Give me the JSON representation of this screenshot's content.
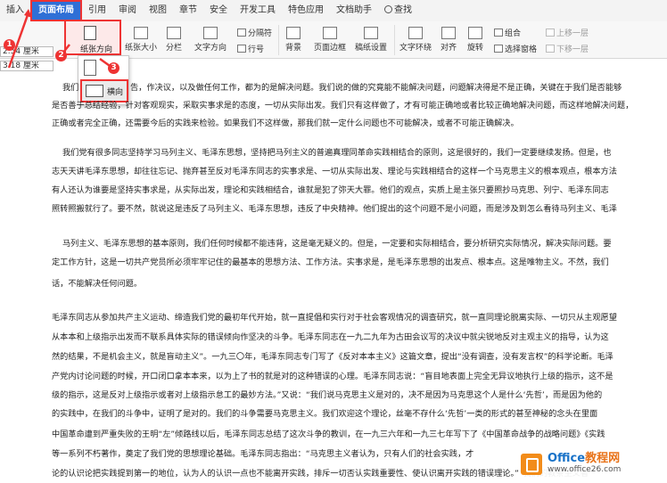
{
  "menubar": {
    "items": [
      "插入",
      "页面布局",
      "引用",
      "审阅",
      "视图",
      "章节",
      "安全",
      "开发工具",
      "特色应用",
      "文档助手"
    ],
    "search_label": "查找"
  },
  "ribbon": {
    "margin_top_value": "2.54 厘米",
    "margin_left_value": "3.18 厘米",
    "orientation_label": "纸张方向",
    "size_label": "纸张大小",
    "columns_label": "分栏",
    "text_direction_label": "文字方向",
    "page_break_label": "分隔符",
    "line_number_label": "行号",
    "background_label": "背景",
    "page_border_label": "页面边框",
    "draft_label": "稿纸设置",
    "text_wrap_label": "文字环绕",
    "align_label": "对齐",
    "rotate_label": "旋转",
    "group_label": "组合",
    "select_pane_label": "选择窗格",
    "bring_forward_label": "上移一层",
    "send_backward_label": "下移一层"
  },
  "orientation_menu": {
    "landscape_label": "横向"
  },
  "badges": [
    "1",
    "2",
    "3"
  ],
  "document": {
    "lines": [
      "我们",
      "告，作决议，以及做任何工作，都为的是解决问题。我们说的做的究竟能不能解决问题，问题解决得是不是正确，关键在于我们是否能够",
      "是否善于总结经验，针对客观现实，采取实事求是的态度，一切从实际出发。我们只有这样做了，才有可能正确地或者比较正确地解决问题，而这样地解决问题，",
      "正确或者完全正确，还需要今后的实践来检验。如果我们不这样做，那我们就一定什么问题也不可能解决，或者不可能正确解决。",
      "我们党有很多同志坚持学习马列主义、毛泽东思想，坚持把马列主义的普遍真理同革命实践相结合的原则，这是很好的，我们一定要继续发扬。但是，也",
      "志天天讲毛泽东思想，却往往忘记、抛弃甚至反对毛泽东同志的实事求是、一切从实际出发、理论与实践相结合的这样一个马克思主义的根本观点，根本方法",
      "有人还认为谁要是坚持实事求是，从实际出发，理论和实践相结合，谁就是犯了弥天大罪。他们的观点，实质上是主张只要照抄马克思、列宁、毛泽东同志",
      "照转照搬就行了。要不然，就说这是违反了马列主义、毛泽东思想，违反了中央精神。他们提出的这个问题不是小问题，而是涉及到怎么看待马列主义、毛泽",
      "马列主义、毛泽东思想的基本原则，我们任何时候都不能违背，这是毫无疑义的。但是，一定要和实际相结合，要分析研究实际情况，解决实际问题。要",
      "定工作方针，这是一切共产党员所必须牢牢记住的最基本的思想方法、工作方法。实事求是，是毛泽东思想的出发点、根本点。这是唯物主义。不然，我们",
      "话，不能解决任何问题。",
      "毛泽东同志从参加共产主义运动、缔造我们党的最初年代开始，就一直提倡和实行对于社会客观情况的调查研究，就一直同理论脱离实际、一切只从主观愿望",
      "从本本和上级指示出发而不联系具体实际的错误倾向作坚决的斗争。毛泽东同志在一九二九年为古田会议写的决议中就尖锐地反对主观主义的指导，认为这",
      "然的结果，不是机会主义，就是盲动主义”。一九三〇年，毛泽东同志专门写了《反对本本主义》这篇文章，提出“没有调查，没有发言权”的科学论断。毛泽",
      "产党内讨论问题的时候，开口闭口拿本本来，以为上了书的就是对的这种错误的心理。毛泽东同志说：“盲目地表面上完全无异议地执行上级的指示，这不是",
      "级的指示，这是反对上级指示或者对上级指示怠工的最妙方法。”又说：“我们说马克思主义是对的，决不是因为马克思这个人是什么‘先哲’，而是因为他的",
      "的实践中，在我们的斗争中，证明了是对的。我们的斗争需要马克思主义。我们欢迎这个理论，丝毫不存什么‘先哲’一类的形式的甚至神秘的念头在里面",
      "中国革命遭到严重失败的王明“左”倾路线以后，毛泽东同志总结了这次斗争的教训，在一九三六年和一九三七年写下了《中国革命战争的战略问题》《实践",
      "等一系列不朽著作，奠定了我们党的思想理论基础。毛泽东同志指出：“马克思主义者认为，只有人们的社会实践，才",
      "论的认识论把实践提到第一的地位，认为人的认识一点也不能离开实践，排斥一切否认实践重要性、使认识离开实践的错误理论。”“我们的教条主义者"
    ]
  },
  "watermark": {
    "title_a": "Office",
    "title_b": "教程网",
    "url": "www.office26.com"
  }
}
